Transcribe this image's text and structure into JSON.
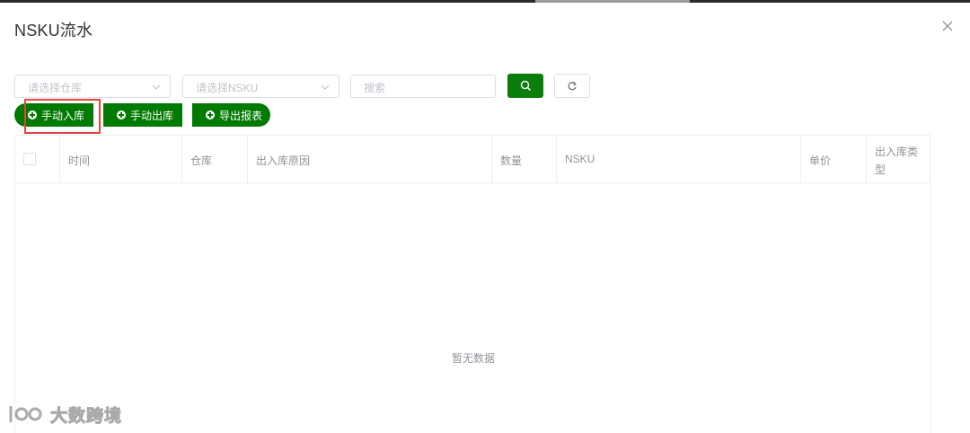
{
  "dialog": {
    "title": "NSKU流水"
  },
  "filters": {
    "warehouse_placeholder": "请选择仓库",
    "nsku_placeholder": "请选择NSKU",
    "search_placeholder": "搜索"
  },
  "actions": {
    "manual_in": "手动入库",
    "manual_out": "手动出库",
    "export": "导出报表"
  },
  "table": {
    "columns": [
      "时间",
      "仓库",
      "出入库原因",
      "数量",
      "NSKU",
      "单价",
      "出入库类型"
    ],
    "rows": [],
    "empty_text": "暂无数据"
  },
  "colors": {
    "primary_green": "#007a00",
    "highlight_red": "#e2453c"
  },
  "watermark": {
    "text": "大数跨境"
  }
}
